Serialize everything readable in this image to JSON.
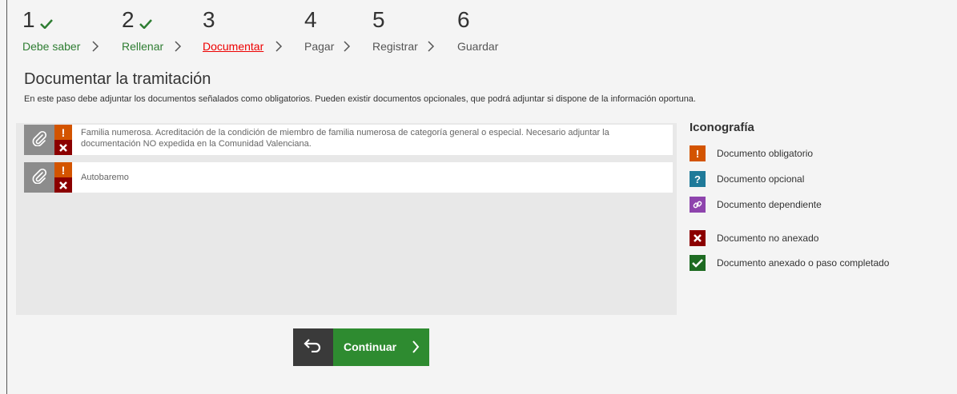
{
  "steps": [
    {
      "number": "1",
      "label": "Debe saber",
      "state": "done"
    },
    {
      "number": "2",
      "label": "Rellenar",
      "state": "done"
    },
    {
      "number": "3",
      "label": "Documentar",
      "state": "current"
    },
    {
      "number": "4",
      "label": "Pagar",
      "state": "pending"
    },
    {
      "number": "5",
      "label": "Registrar",
      "state": "pending"
    },
    {
      "number": "6",
      "label": "Guardar",
      "state": "pending"
    }
  ],
  "page": {
    "title": "Documentar la tramitación",
    "description": "En este paso debe adjuntar los documentos señalados como obligatorios. Pueden existir documentos opcionales, que podrá adjuntar si dispone de la información oportuna."
  },
  "documents": [
    {
      "text": "Familia numerosa. Acreditación de la condición de miembro de familia numerosa de categoría general o especial. Necesario adjuntar la documentación NO expedida en la Comunidad Valenciana.",
      "type": "obligatorio",
      "status": "no anexado"
    },
    {
      "text": "Autobaremo",
      "type": "obligatorio",
      "status": "no anexado"
    }
  ],
  "legend": {
    "title": "Iconografía",
    "items": [
      {
        "label": "Documento obligatorio",
        "icon": "exclamation-icon",
        "color": "#d35400"
      },
      {
        "label": "Documento opcional",
        "icon": "question-icon",
        "color": "#1f7a99"
      },
      {
        "label": "Documento dependiente",
        "icon": "link-icon",
        "color": "#8e44ad"
      },
      {
        "label": "Documento no anexado",
        "icon": "x-icon",
        "color": "#8b0000"
      },
      {
        "label": "Documento anexado o paso completado",
        "icon": "check-icon",
        "color": "#1e6b22"
      }
    ]
  },
  "actions": {
    "continue_label": "Continuar"
  },
  "colors": {
    "done": "#2e7d32",
    "current": "#e00000",
    "continue": "#2e8b30",
    "back": "#3a3a3a"
  }
}
